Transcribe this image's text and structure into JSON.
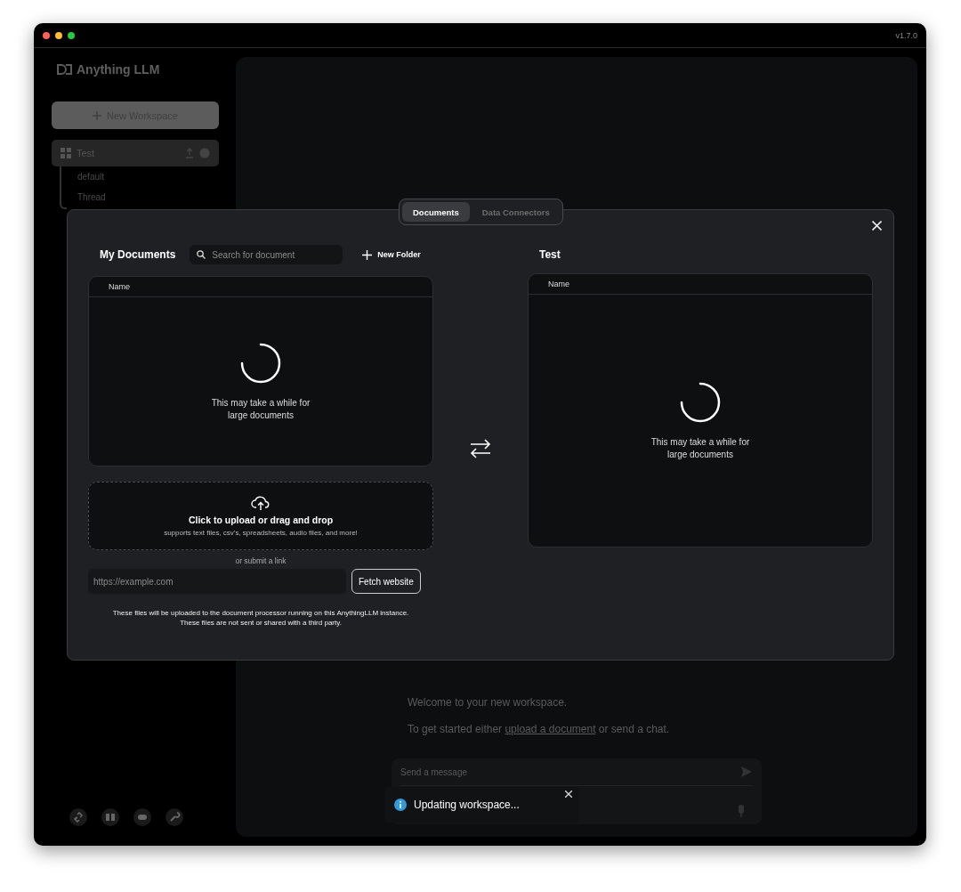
{
  "window": {
    "version": "v1.7.0"
  },
  "sidebar": {
    "logo": "Anything LLM",
    "new_workspace": "New Workspace",
    "workspaces": [
      {
        "name": "Test",
        "selected": true,
        "threads": [
          {
            "name": "default"
          },
          {
            "name": "Thread"
          }
        ]
      }
    ]
  },
  "main": {
    "welcome": "Welcome to your new workspace.",
    "hint_before": "To get started either",
    "hint_link": "upload a document",
    "hint_after": "or send a chat."
  },
  "chat": {
    "placeholder": "Send a message"
  },
  "modal": {
    "tabs": [
      {
        "label": "Documents",
        "selected": true
      },
      {
        "label": "Data Connectors",
        "selected": false
      }
    ],
    "my_documents": {
      "title": "My Documents",
      "search_placeholder": "Search for document",
      "new_folder": "New Folder",
      "column": "Name",
      "loading": "This may take a while for\nlarge documents"
    },
    "workspace": {
      "title": "Test",
      "column": "Name",
      "loading": "This may take a while for\nlarge documents"
    },
    "upload": {
      "title": "Click to upload or drag and drop",
      "subtitle": "supports text files, csv's, spreadsheets, audio files, and more!"
    },
    "link_divider": "or submit a link",
    "url_placeholder": "https://example.com",
    "fetch_button": "Fetch website",
    "notice": "These files will be uploaded to the document processor running on this AnythingLLM instance.\nThese files are not sent or shared with a third party."
  },
  "toast": {
    "kind": "info",
    "message": "Updating workspace..."
  }
}
